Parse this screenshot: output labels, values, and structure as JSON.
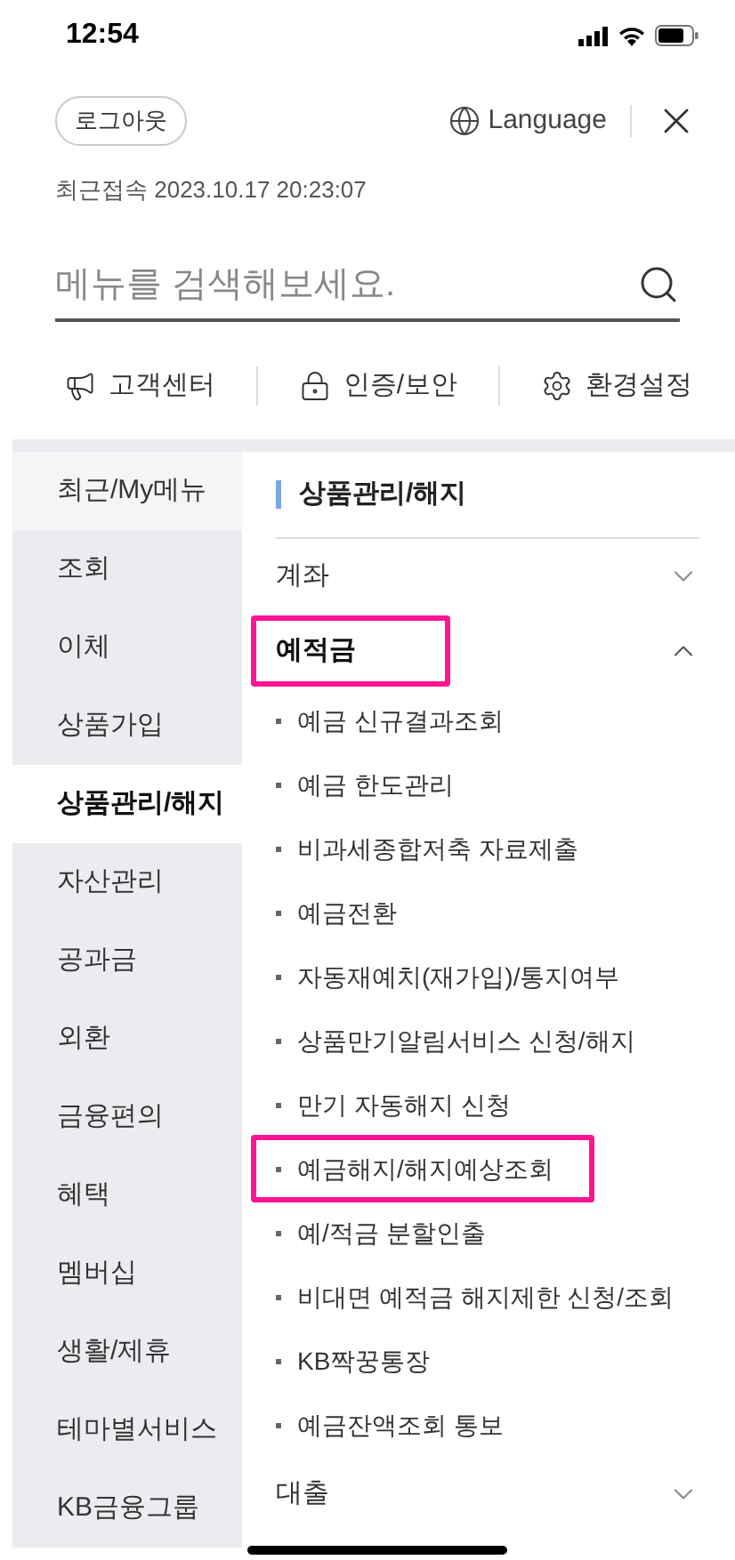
{
  "status_bar": {
    "time": "12:54"
  },
  "header": {
    "logout_button": "로그아웃",
    "language_button": "Language",
    "last_login": "최근접속 2023.10.17 20:23:07"
  },
  "search": {
    "placeholder": "메뉴를 검색해보세요."
  },
  "quick_links": [
    {
      "kind": "megaphone",
      "label": "고객센터"
    },
    {
      "kind": "lock",
      "label": "인증/보안"
    },
    {
      "kind": "gear",
      "label": "환경설정"
    }
  ],
  "sidebar": {
    "items": [
      {
        "kind": "recent",
        "label": "최근/My메뉴",
        "selected": false
      },
      {
        "kind": "menu",
        "label": "조회",
        "selected": false
      },
      {
        "kind": "menu",
        "label": "이체",
        "selected": false
      },
      {
        "kind": "menu",
        "label": "상품가입",
        "selected": false
      },
      {
        "kind": "menu",
        "label": "상품관리/해지",
        "selected": true
      },
      {
        "kind": "menu",
        "label": "자산관리",
        "selected": false
      },
      {
        "kind": "menu",
        "label": "공과금",
        "selected": false
      },
      {
        "kind": "menu",
        "label": "외환",
        "selected": false
      },
      {
        "kind": "menu",
        "label": "금융편의",
        "selected": false
      },
      {
        "kind": "menu",
        "label": "혜택",
        "selected": false
      },
      {
        "kind": "menu",
        "label": "멤버십",
        "selected": false
      },
      {
        "kind": "menu",
        "label": "생활/제휴",
        "selected": false
      },
      {
        "kind": "menu",
        "label": "테마별서비스",
        "selected": false
      },
      {
        "kind": "menu",
        "label": "KB금융그룹",
        "selected": false
      }
    ]
  },
  "panel": {
    "title": "상품관리/해지",
    "sections": [
      {
        "label": "계좌",
        "expanded": false,
        "highlighted": false
      },
      {
        "label": "예적금",
        "expanded": true,
        "highlighted": true,
        "children": [
          {
            "label": "예금 신규결과조회",
            "highlighted": false
          },
          {
            "label": "예금 한도관리",
            "highlighted": false
          },
          {
            "label": "비과세종합저축 자료제출",
            "highlighted": false
          },
          {
            "label": "예금전환",
            "highlighted": false
          },
          {
            "label": "자동재예치(재가입)/통지여부",
            "highlighted": false
          },
          {
            "label": "상품만기알림서비스 신청/해지",
            "highlighted": false
          },
          {
            "label": "만기 자동해지 신청",
            "highlighted": false
          },
          {
            "label": "예금해지/해지예상조회",
            "highlighted": true
          },
          {
            "label": "예/적금 분할인출",
            "highlighted": false
          },
          {
            "label": "비대면 예적금 해지제한 신청/조회",
            "highlighted": false
          },
          {
            "label": "KB짝꿍통장",
            "highlighted": false
          },
          {
            "label": "예금잔액조회 통보",
            "highlighted": false
          }
        ]
      },
      {
        "label": "대출",
        "expanded": false,
        "highlighted": false
      }
    ]
  }
}
